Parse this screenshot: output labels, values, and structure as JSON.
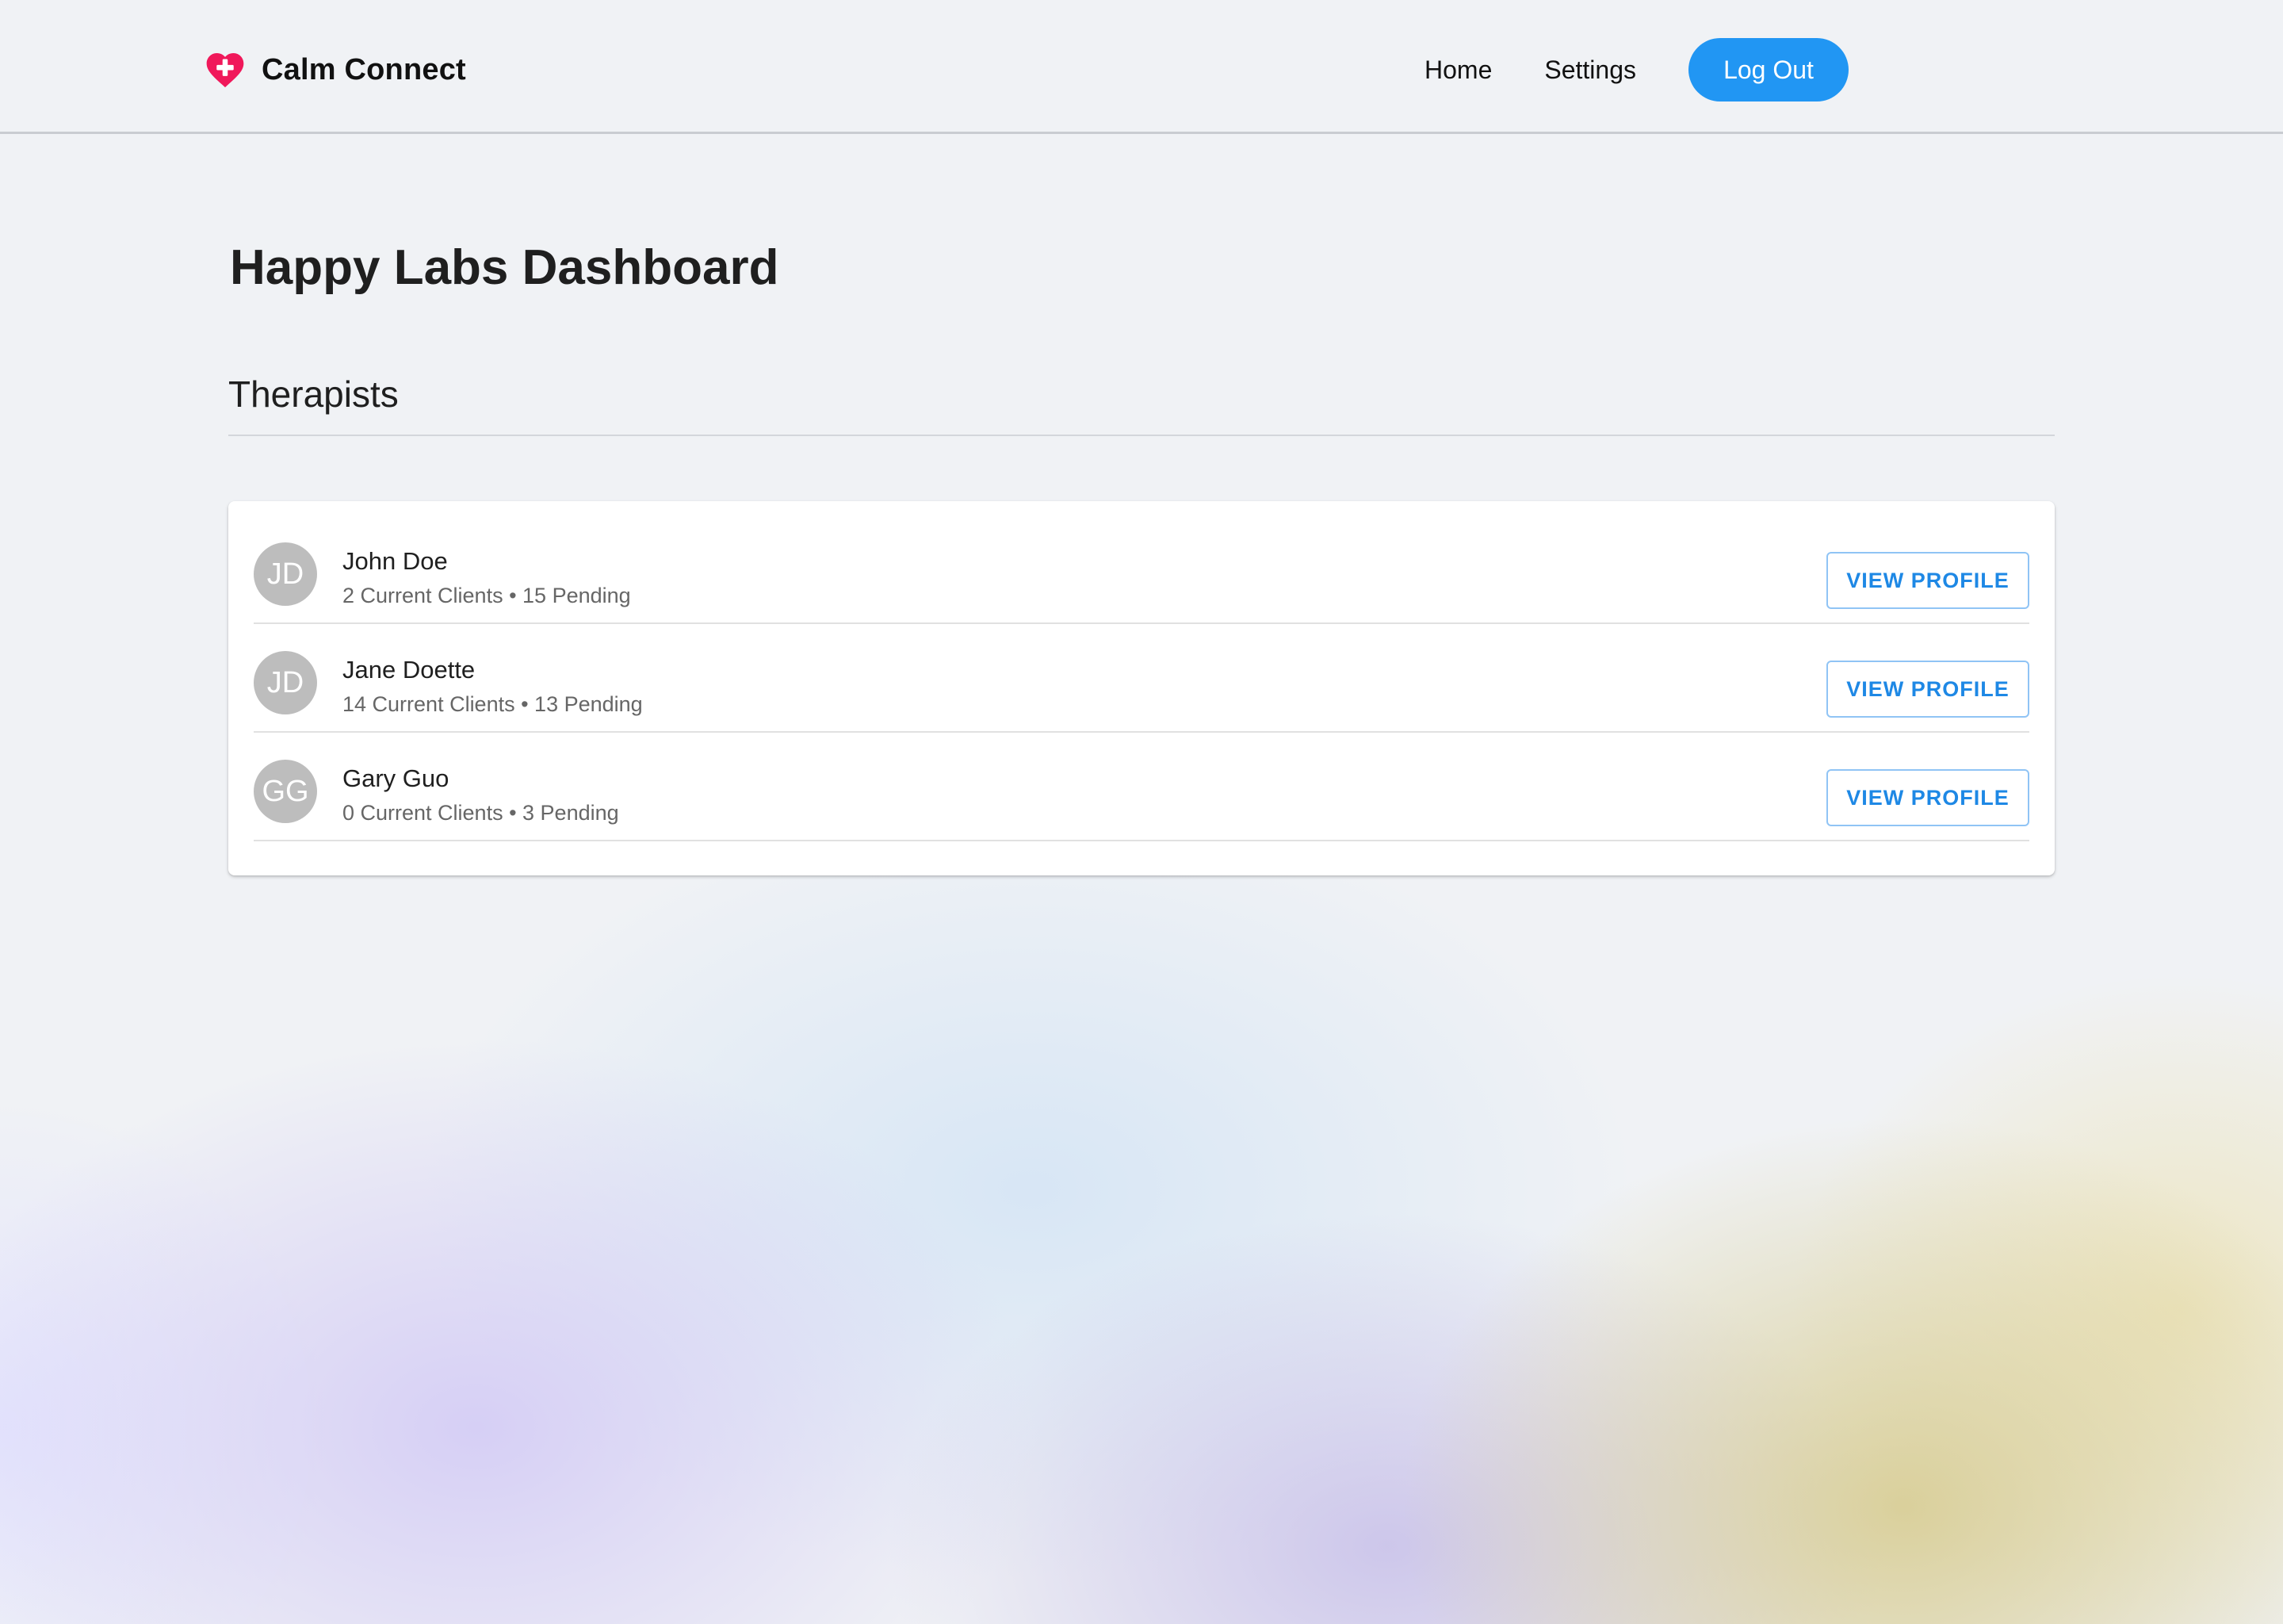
{
  "header": {
    "brand_icon": "heart-plus-icon",
    "brand_name": "Calm Connect",
    "nav": {
      "home_label": "Home",
      "settings_label": "Settings",
      "logout_label": "Log Out"
    }
  },
  "main": {
    "title": "Happy Labs Dashboard",
    "section_heading": "Therapists",
    "therapists": [
      {
        "initials": "JD",
        "name": "John Doe",
        "meta": "2 Current Clients • 15 Pending",
        "action_label": "VIEW PROFILE"
      },
      {
        "initials": "JD",
        "name": "Jane Doette",
        "meta": "14 Current Clients • 13 Pending",
        "action_label": "VIEW PROFILE"
      },
      {
        "initials": "GG",
        "name": "Gary Guo",
        "meta": "0 Current Clients • 3 Pending",
        "action_label": "VIEW PROFILE"
      }
    ]
  },
  "colors": {
    "accent": "#2196f3",
    "brand_heart": "#f0185a",
    "avatar_bg": "#bdbdbd",
    "outline_button_text": "#1e88e5"
  }
}
